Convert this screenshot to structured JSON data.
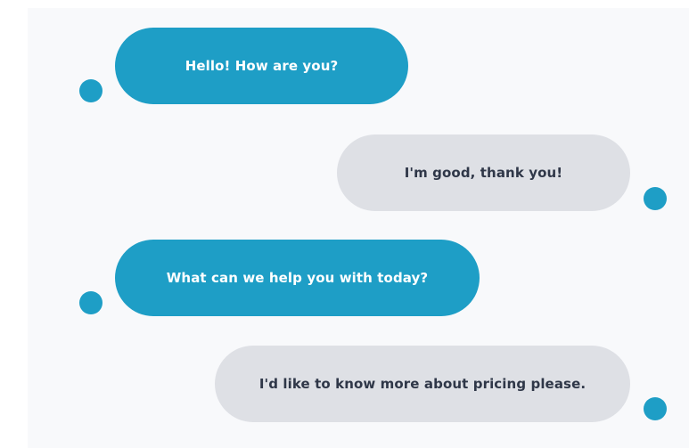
{
  "colors": {
    "bot_bubble": "#1e9ec6",
    "user_bubble": "#dee0e5",
    "bot_avatar": "#1e9ec6",
    "user_avatar": "#1e9ec6"
  },
  "conversation": {
    "messages": [
      {
        "sender": "bot",
        "text": "Hello! How are you?"
      },
      {
        "sender": "user",
        "text": "I'm good, thank you!"
      },
      {
        "sender": "bot",
        "text": "What can we help you with today?"
      },
      {
        "sender": "user",
        "text": "I'd like to know more about pricing please."
      }
    ]
  }
}
